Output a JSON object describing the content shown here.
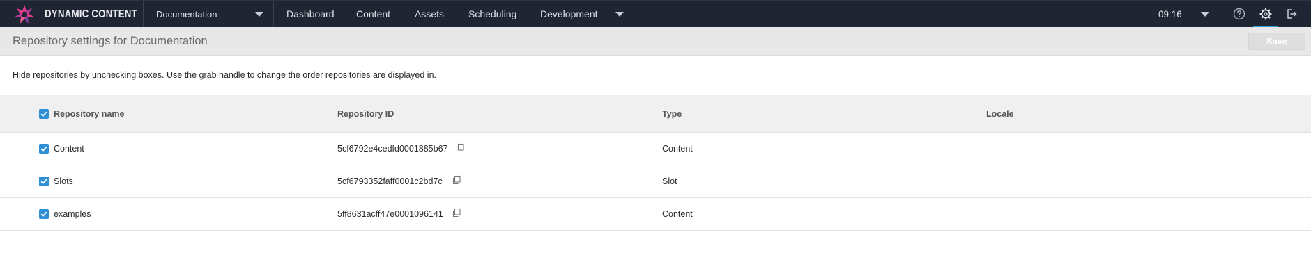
{
  "topbar": {
    "brand": "DYNAMIC CONTENT",
    "hub": "Documentation",
    "nav": [
      "Dashboard",
      "Content",
      "Assets",
      "Scheduling",
      "Development"
    ],
    "time": "09:16"
  },
  "header": {
    "title": "Repository settings for Documentation",
    "save_label": "Save"
  },
  "instructions": "Hide repositories by unchecking boxes. Use the grab handle to change the order repositories are displayed in.",
  "table": {
    "columns": [
      "Repository name",
      "Repository ID",
      "Type",
      "Locale"
    ],
    "rows": [
      {
        "name": "Content",
        "id": "5cf6792e4cedfd0001885b67",
        "type": "Content",
        "locale": "",
        "checked": true
      },
      {
        "name": "Slots",
        "id": "5cf6793352faff0001c2bd7c",
        "type": "Slot",
        "locale": "",
        "checked": true
      },
      {
        "name": "examples",
        "id": "5ff8631acff47e0001096141",
        "type": "Content",
        "locale": "",
        "checked": true
      }
    ]
  },
  "colors": {
    "topbar_bg": "#1f2533",
    "accent": "#2e8fd6",
    "brand_pink": "#e23d8c"
  },
  "icons": [
    "dynamic-content-logo",
    "chevron-down-icon",
    "help-icon",
    "gear-icon",
    "logout-icon",
    "copy-icon",
    "checkbox-checked-icon"
  ]
}
